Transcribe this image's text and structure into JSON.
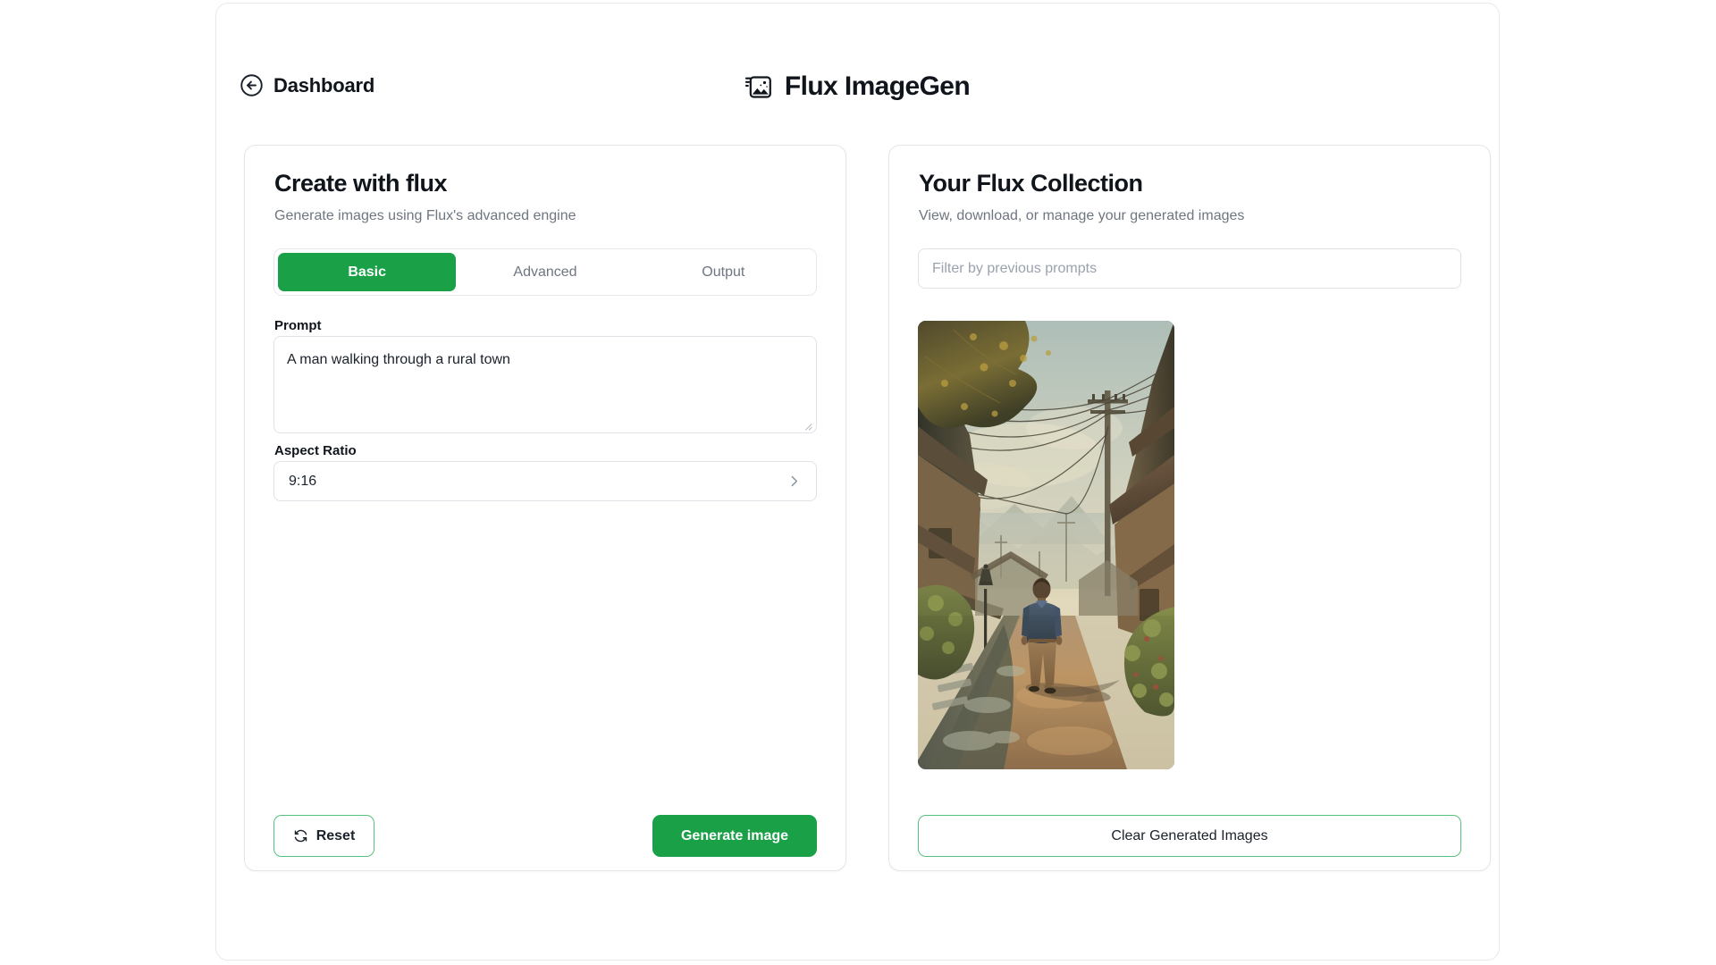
{
  "header": {
    "back_label": "Dashboard",
    "back_icon": "arrow-left-circle-icon",
    "app_title": "Flux ImageGen",
    "app_icon": "image-sparkle-icon"
  },
  "left_panel": {
    "title": "Create with flux",
    "subtitle": "Generate images using Flux's advanced engine",
    "tabs": [
      {
        "label": "Basic",
        "active": true
      },
      {
        "label": "Advanced",
        "active": false
      },
      {
        "label": "Output",
        "active": false
      }
    ],
    "prompt": {
      "label": "Prompt",
      "value": "A man walking through a rural town",
      "placeholder": "A man walking through a rural town"
    },
    "aspect_ratio": {
      "label": "Aspect Ratio",
      "value": "9:16",
      "chevron_icon": "chevron-right-icon"
    },
    "reset_button": {
      "label": "Reset",
      "icon": "refresh-icon"
    },
    "generate_button": {
      "label": "Generate image"
    }
  },
  "right_panel": {
    "title": "Your Flux Collection",
    "subtitle": "View, download, or manage your generated images",
    "filter": {
      "value": "",
      "placeholder": "Filter by previous prompts"
    },
    "thumbnail": {
      "alt": "A man walking through a rural town",
      "aspect_ratio": "9:16"
    },
    "clear_button": {
      "label": "Clear Generated Images"
    }
  },
  "colors": {
    "accent_green": "#1aa148",
    "accent_green_border": "#57c07d",
    "text_primary": "#10151c",
    "text_muted": "#6e7681",
    "panel_border": "#e3e5e8"
  }
}
